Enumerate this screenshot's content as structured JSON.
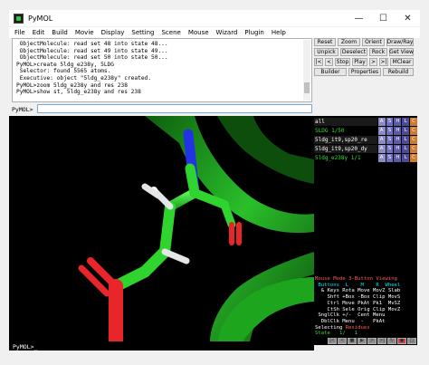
{
  "window": {
    "title": "PyMOL",
    "minimize": "—",
    "maximize": "☐",
    "close": "✕"
  },
  "menu": [
    "File",
    "Edit",
    "Build",
    "Movie",
    "Display",
    "Setting",
    "Scene",
    "Mouse",
    "Wizard",
    "Plugin",
    "Help"
  ],
  "console": {
    "lines": [
      " ObjectMolecule: read set 48 into state 48...",
      " ObjectMolecule: read set 49 into state 49...",
      " ObjectMolecule: read set 50 into state 50...",
      "PyMOL>create 5ldg_e238y, 5LDG",
      " Selector: found 5565 atoms.",
      " Executive: object \"5ldg_e238y\" created.",
      "PyMOL>zoom 5ldg_e238y and res 238",
      "PyMOL>show st, 5ldg_e238y and res 238"
    ]
  },
  "buttons": {
    "reset": "Reset",
    "zoom": "Zoom",
    "orient": "Orient",
    "draw_ray": "Draw/Ray",
    "unpick": "Unpick",
    "deselect": "Deselect",
    "rock": "Rock",
    "get_view": "Get View",
    "first": "|<",
    "prev": "<",
    "stop": "Stop",
    "play": "Play",
    "next": ">",
    "last": ">|",
    "mclear": "MClear",
    "builder": "Builder",
    "properties": "Properties",
    "rebuild": "Rebuild"
  },
  "prompt": {
    "label": "PyMOL>",
    "value": "",
    "viewer_prompt": "PyMOL>_"
  },
  "objects": [
    {
      "name": "all",
      "color": "#ffffff",
      "bg": "#1a1a1a"
    },
    {
      "name": "5LDG",
      "color": "#35e035",
      "bg": "#000000",
      "state": "1/50"
    },
    {
      "name": "5ldg_it9,sp20_re",
      "color": "#ffffff",
      "bg": "#1a1a1a"
    },
    {
      "name": "5ldg_it9,sp20_dy",
      "color": "#ffffff",
      "bg": "#1a1a1a"
    },
    {
      "name": "5ldg_e238y",
      "color": "#35e035",
      "bg": "#000000",
      "state": "1/1"
    }
  ],
  "object_buttons": {
    "a": "A",
    "s": "S",
    "h": "H",
    "l": "L",
    "c": "C"
  },
  "mouse_mode": {
    "header": "Mouse Mode 3-Button Viewing",
    "row_buttons": " Buttons  L    M    R  Wheel",
    "row_keys": "  & Keys Rota Move MovZ Slab",
    "row_shft": "    Shft +Box -Box Clip MovS",
    "row_ctrl": "    Ctrl Move PkAt Pk1  MvSZ",
    "row_ctsh": "    CtSh Sele Orig Clip MovZ",
    "row_sngl": " SnglClk +/-  Cent Menu",
    "row_dbl": "  DblClk Menu  -   PkAt",
    "selecting_label": "Selecting",
    "selecting_value": "Residues",
    "state_label": "State",
    "state_value": "1/   1"
  },
  "colors": {
    "background": "#f0f0f0",
    "viewer": "#000000",
    "carbon": "#33e633",
    "oxygen": "#e8262a",
    "nitrogen": "#2233e6",
    "hydrogen": "#e6e6e6"
  }
}
